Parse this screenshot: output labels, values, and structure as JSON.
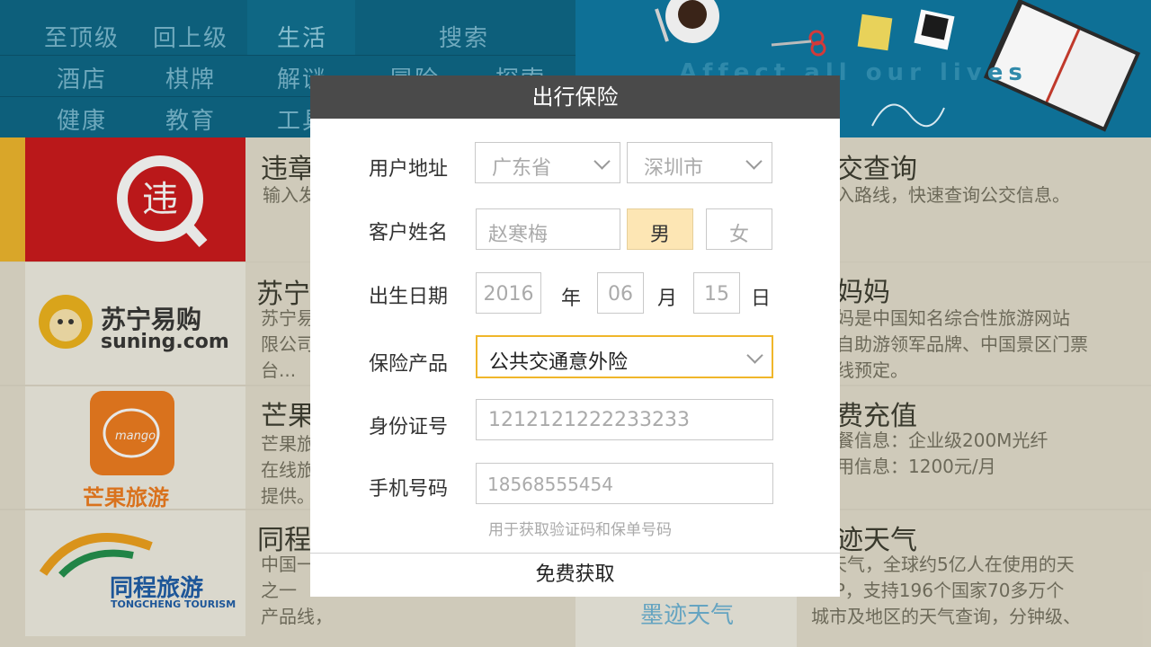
{
  "nav": {
    "row1": [
      "至顶级",
      "回上级",
      "生活",
      "搜索"
    ],
    "row2": [
      "酒店",
      "棋牌",
      "解谜",
      "冒险",
      "探索"
    ],
    "row3": [
      "健康",
      "教育",
      "工具"
    ]
  },
  "banner": {
    "tagline": "Affect all our lives"
  },
  "list": [
    {
      "title": "违章",
      "desc": "输入发",
      "right_title": "交查询",
      "right_desc": "入路线，快速查询公交信息。"
    },
    {
      "title": "苏宁",
      "desc": "苏宁易\n限公司\n台...",
      "logo_cn": "苏宁易购",
      "logo_en": "suning.com",
      "right_title": "妈妈",
      "right_desc": "妈是中国知名综合性旅游网站\n自助游领军品牌、中国景区门票\n线预定。"
    },
    {
      "title": "芒果",
      "desc": "芒果旅\n在线旅\n提供。",
      "logo_cn": "芒果旅游",
      "logo_en": "mango",
      "right_title": "费充值",
      "right_desc": "餐信息：企业级200M光纤\n用信息：1200元/月"
    },
    {
      "title": "同程",
      "desc": "中国一\n之一\n产品线，",
      "logo_cn": "同程旅游",
      "logo_en": "TONGCHENG TOURISM",
      "right_title": "迹天气",
      "right_desc": "迹天气，全球约5亿人在使用的天\nAPP，支持196个国家70多万个\n城市及地区的天气查询，分钟级、",
      "mid_logo": "墨迹天气"
    }
  ],
  "modal": {
    "title": "出行保险",
    "address_label": "用户地址",
    "province": "广东省",
    "city": "深圳市",
    "name_label": "客户姓名",
    "name_placeholder": "赵寒梅",
    "gender_male": "男",
    "gender_female": "女",
    "gender_selected": "男",
    "birth_label": "出生日期",
    "birth_year": "2016",
    "year_unit": "年",
    "birth_month": "06",
    "month_unit": "月",
    "birth_day": "15",
    "day_unit": "日",
    "product_label": "保险产品",
    "product_value": "公共交通意外险",
    "id_label": "身份证号",
    "id_value": "1212121222233233",
    "phone_label": "手机号码",
    "phone_value": "18568555454",
    "hint": "用于获取验证码和保单号码",
    "submit": "免费获取"
  },
  "colors": {
    "accent": "#f0b62a",
    "selected_bg": "#fde6b4",
    "header_bg": "#4a4a4a"
  }
}
